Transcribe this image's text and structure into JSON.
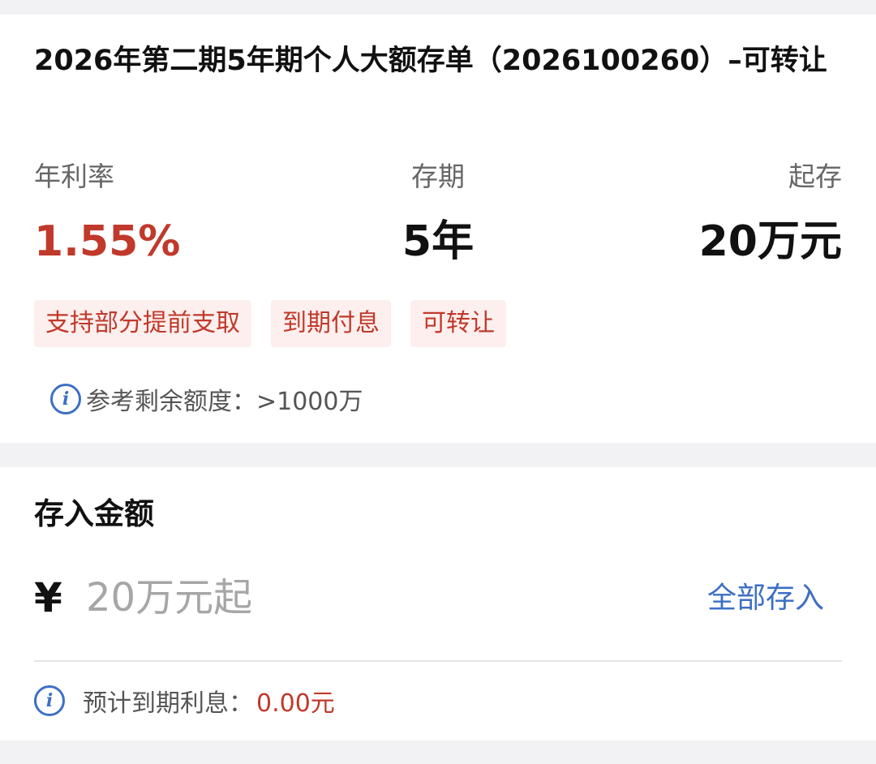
{
  "product": {
    "title": "2026年第二期5年期个人大额存单（2026100260）–可转让"
  },
  "stats": {
    "rate_label": "年利率",
    "rate_value": "1.55%",
    "term_label": "存期",
    "term_value": "5年",
    "min_label": "起存",
    "min_value": "20万元"
  },
  "tags": [
    "支持部分提前支取",
    "到期付息",
    "可转让"
  ],
  "quota": {
    "label": "参考剩余额度：",
    "value": ">1000万"
  },
  "deposit": {
    "section_title": "存入金额",
    "currency_symbol": "¥",
    "amount_placeholder": "20万元起",
    "deposit_all_label": "全部存入"
  },
  "interest": {
    "label": "预计到期利息：",
    "value": "0.00元"
  },
  "icons": {
    "info": "info-icon"
  },
  "colors": {
    "accent_red": "#c0392b",
    "link_blue": "#3d6fc4",
    "tag_bg": "#fcefed"
  }
}
